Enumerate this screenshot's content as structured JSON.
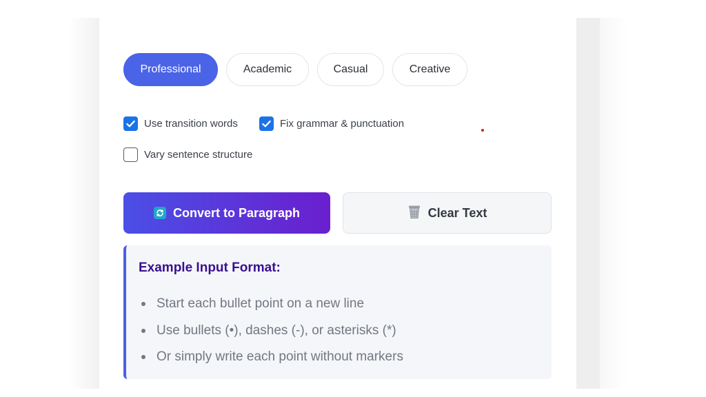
{
  "tones": [
    {
      "label": "Professional",
      "active": true
    },
    {
      "label": "Academic",
      "active": false
    },
    {
      "label": "Casual",
      "active": false
    },
    {
      "label": "Creative",
      "active": false
    }
  ],
  "options": [
    {
      "label": "Use transition words",
      "checked": true
    },
    {
      "label": "Fix grammar & punctuation",
      "checked": true
    },
    {
      "label": "Vary sentence structure",
      "checked": false
    }
  ],
  "actions": {
    "convert_label": "Convert to Paragraph",
    "convert_icon": "refresh-icon",
    "clear_label": "Clear Text",
    "clear_icon": "wastebasket-icon"
  },
  "example": {
    "title": "Example Input Format:",
    "items": [
      "Start each bullet point on a new line",
      "Use bullets (•), dashes (-), or asterisks (*)",
      "Or simply write each point without markers"
    ]
  },
  "colors": {
    "accent": "#4a63e7",
    "gradient_start": "#4b4fe6",
    "gradient_end": "#6a1fce",
    "checkbox": "#1a73e8",
    "example_title": "#3a0f8f"
  }
}
